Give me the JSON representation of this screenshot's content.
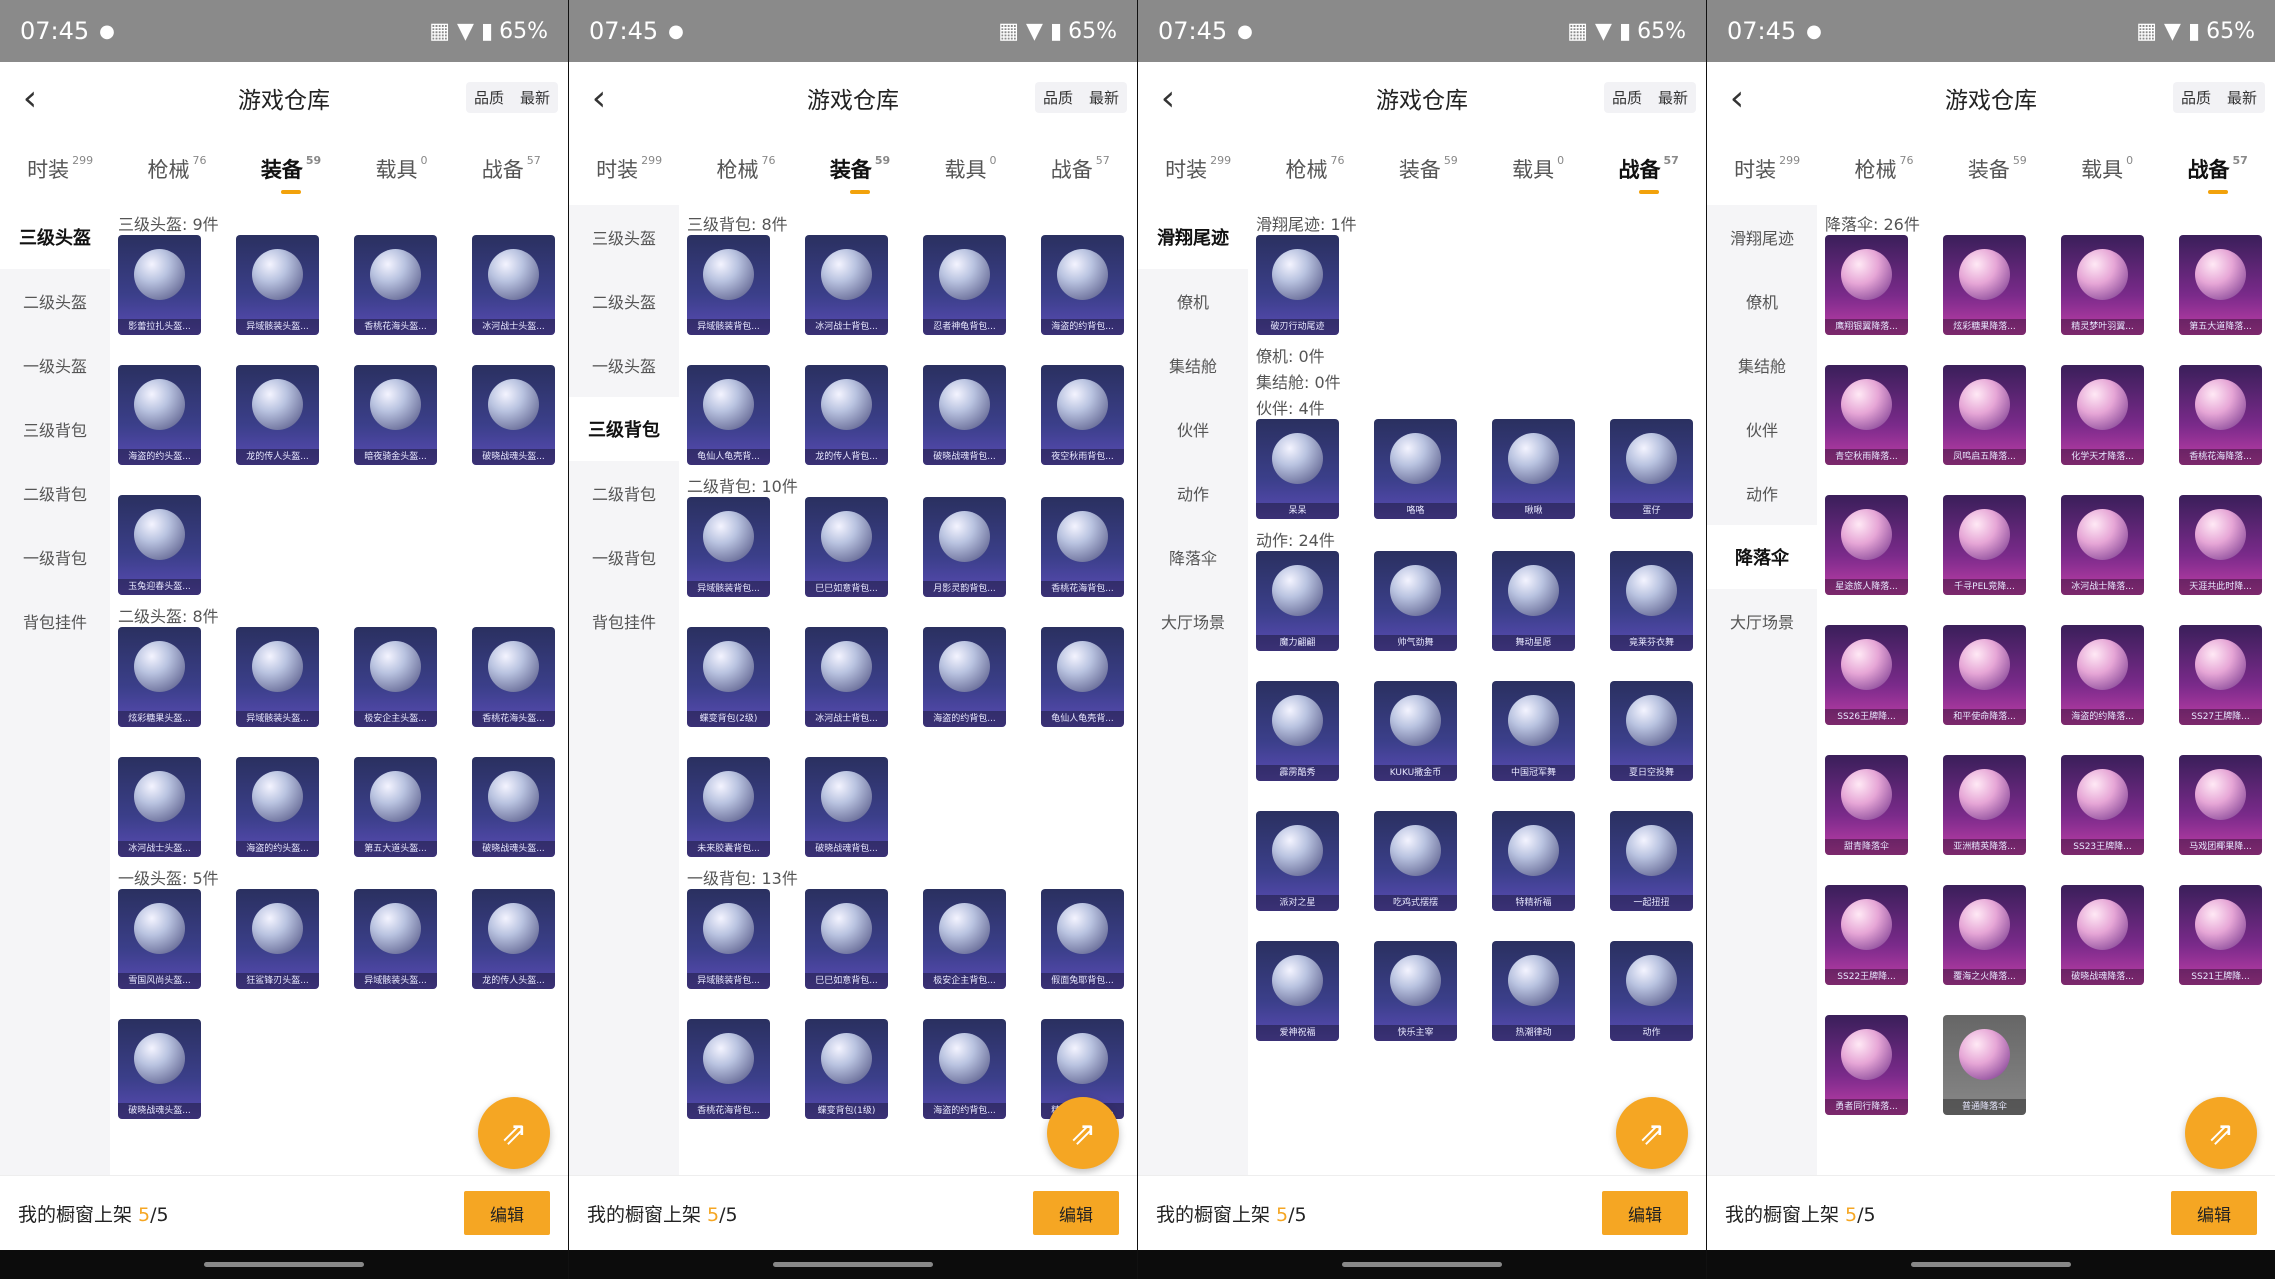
{
  "colors": {
    "accent": "#f5a623",
    "card_blue": "#3b3f8a",
    "card_purple": "#c03fa8"
  },
  "panels": [
    {
      "status": {
        "time": "07:45",
        "battery": "65%"
      },
      "nav": {
        "back_icon": "chevron-left-icon",
        "title": "游戏仓库",
        "sort_quality": "品质",
        "sort_latest": "最新"
      },
      "tabs": [
        {
          "label": "时装",
          "count": "299"
        },
        {
          "label": "枪械",
          "count": "76"
        },
        {
          "label": "装备",
          "count": "59"
        },
        {
          "label": "载具",
          "count": "0"
        },
        {
          "label": "战备",
          "count": "57"
        }
      ],
      "active_tab": 2,
      "sidebar": [
        "三级头盔",
        "二级头盔",
        "一级头盔",
        "三级背包",
        "二级背包",
        "一级背包",
        "背包挂件"
      ],
      "active_side": 0,
      "sections": [
        {
          "label": "三级头盔: 9件",
          "items": [
            "影蕾拉扎头盔...",
            "异域骸装头盔...",
            "香桃花海头盔...",
            "冰河战士头盔...",
            "海盗的约头盔...",
            "龙的传人头盔...",
            "暗夜骑金头盔...",
            "破晓战魂头盔...",
            "玉兔迎春头盔..."
          ]
        },
        {
          "label": "二级头盔: 8件",
          "items": [
            "炫彩糖果头盔...",
            "异域骸装头盔...",
            "极安企主头盔...",
            "香桃花海头盔...",
            "冰河战士头盔...",
            "海盗的约头盔...",
            "第五大道头盔...",
            "破晓战魂头盔..."
          ]
        },
        {
          "label": "一级头盔: 5件",
          "items": [
            "雪国风尚头盔...",
            "狂鲨锋刃头盔...",
            "异域骸装头盔...",
            "龙的传人头盔...",
            "破晓战魂头盔..."
          ]
        }
      ],
      "footer": {
        "label": "我的橱窗上架 ",
        "count": "5",
        "total": "/5",
        "edit": "编辑"
      }
    },
    {
      "status": {
        "time": "07:45",
        "battery": "65%"
      },
      "nav": {
        "back_icon": "chevron-left-icon",
        "title": "游戏仓库",
        "sort_quality": "品质",
        "sort_latest": "最新"
      },
      "tabs": [
        {
          "label": "时装",
          "count": "299"
        },
        {
          "label": "枪械",
          "count": "76"
        },
        {
          "label": "装备",
          "count": "59"
        },
        {
          "label": "载具",
          "count": "0"
        },
        {
          "label": "战备",
          "count": "57"
        }
      ],
      "active_tab": 2,
      "sidebar": [
        "三级头盔",
        "二级头盔",
        "一级头盔",
        "三级背包",
        "二级背包",
        "一级背包",
        "背包挂件"
      ],
      "active_side": 3,
      "sections": [
        {
          "label": "三级背包: 8件",
          "items": [
            "异域骸装背包...",
            "冰河战士背包...",
            "忍者神龟背包...",
            "海盗的约背包...",
            "龟仙人龟壳背...",
            "龙的传人背包...",
            "破晓战魂背包...",
            "夜空秋雨背包..."
          ]
        },
        {
          "label": "二级背包: 10件",
          "items": [
            "异域骸装背包...",
            "巳巳如意背包...",
            "月影灵韵背包...",
            "香桃花海背包...",
            "蝶变背包(2级)",
            "冰河战士背包...",
            "海盗的约背包...",
            "龟仙人龟壳背...",
            "未来胶囊背包...",
            "破晓战魂背包..."
          ]
        },
        {
          "label": "一级背包: 13件",
          "items": [
            "异域骸装背包...",
            "巳巳如意背包...",
            "极安企主背包...",
            "假面兔耶背包...",
            "香桃花海背包...",
            "蝶变背包(1级)",
            "海盗的约背包...",
            "精灵梦叶背包..."
          ]
        }
      ],
      "footer": {
        "label": "我的橱窗上架 ",
        "count": "5",
        "total": "/5",
        "edit": "编辑"
      }
    },
    {
      "status": {
        "time": "07:45",
        "battery": "65%"
      },
      "nav": {
        "back_icon": "chevron-left-icon",
        "title": "游戏仓库",
        "sort_quality": "品质",
        "sort_latest": "最新"
      },
      "tabs": [
        {
          "label": "时装",
          "count": "299"
        },
        {
          "label": "枪械",
          "count": "76"
        },
        {
          "label": "装备",
          "count": "59"
        },
        {
          "label": "载具",
          "count": "0"
        },
        {
          "label": "战备",
          "count": "57"
        }
      ],
      "active_tab": 4,
      "sidebar": [
        "滑翔尾迹",
        "僚机",
        "集结舱",
        "伙伴",
        "动作",
        "降落伞",
        "大厅场景"
      ],
      "active_side": 0,
      "sections": [
        {
          "label": "滑翔尾迹: 1件",
          "items": [
            "破刃行动尾迹"
          ]
        },
        {
          "label": "僚机: 0件",
          "items": []
        },
        {
          "label": "集结舱: 0件",
          "items": []
        },
        {
          "label": "伙伴: 4件",
          "items": [
            "呆呆",
            "咯咯",
            "啾啾",
            "蛋仔"
          ]
        },
        {
          "label": "动作: 24件",
          "items": [
            "魔力翩翩",
            "帅气劲舞",
            "舞动星愿",
            "竟莱芬衣舞",
            "霹雳酷秀",
            "KUKU撒金币",
            "中国冠军舞",
            "夏日空投舞",
            "派对之星",
            "吃鸡式摆摆",
            "特精祈福",
            "一起扭扭",
            "爱神祝福",
            "快乐主宰",
            "热潮律动",
            "动作"
          ]
        }
      ],
      "footer": {
        "label": "我的橱窗上架 ",
        "count": "5",
        "total": "/5",
        "edit": "编辑"
      }
    },
    {
      "status": {
        "time": "07:45",
        "battery": "65%"
      },
      "nav": {
        "back_icon": "chevron-left-icon",
        "title": "游戏仓库",
        "sort_quality": "品质",
        "sort_latest": "最新"
      },
      "tabs": [
        {
          "label": "时装",
          "count": "299"
        },
        {
          "label": "枪械",
          "count": "76"
        },
        {
          "label": "装备",
          "count": "59"
        },
        {
          "label": "载具",
          "count": "0"
        },
        {
          "label": "战备",
          "count": "57"
        }
      ],
      "active_tab": 4,
      "sidebar": [
        "滑翔尾迹",
        "僚机",
        "集结舱",
        "伙伴",
        "动作",
        "降落伞",
        "大厅场景"
      ],
      "active_side": 5,
      "sections": [
        {
          "label": "降落伞: 26件",
          "items": [
            "鹰翔银翼降落...",
            "炫彩糖果降落...",
            "精灵梦叶羽翼...",
            "第五大道降落...",
            "青空秋雨降落...",
            "凤鸣启五降落...",
            "化学天才降落...",
            "香桃花海降落...",
            "星途旅人降落...",
            "千寻PEL竞降...",
            "冰河战士降落...",
            "天涯共此时降...",
            "SS26王牌降...",
            "和平使命降落...",
            "海盗的约降落...",
            "SS27王牌降...",
            "甜青降落伞",
            "亚洲精英降落...",
            "SS23王牌降...",
            "马戏团椰果降...",
            "SS22王牌降...",
            "覆海之火降落...",
            "破晓战魂降落...",
            "SS21王牌降...",
            "勇者同行降落...",
            "普通降落伞"
          ]
        }
      ],
      "footer": {
        "label": "我的橱窗上架 ",
        "count": "5",
        "total": "/5",
        "edit": "编辑"
      }
    }
  ]
}
